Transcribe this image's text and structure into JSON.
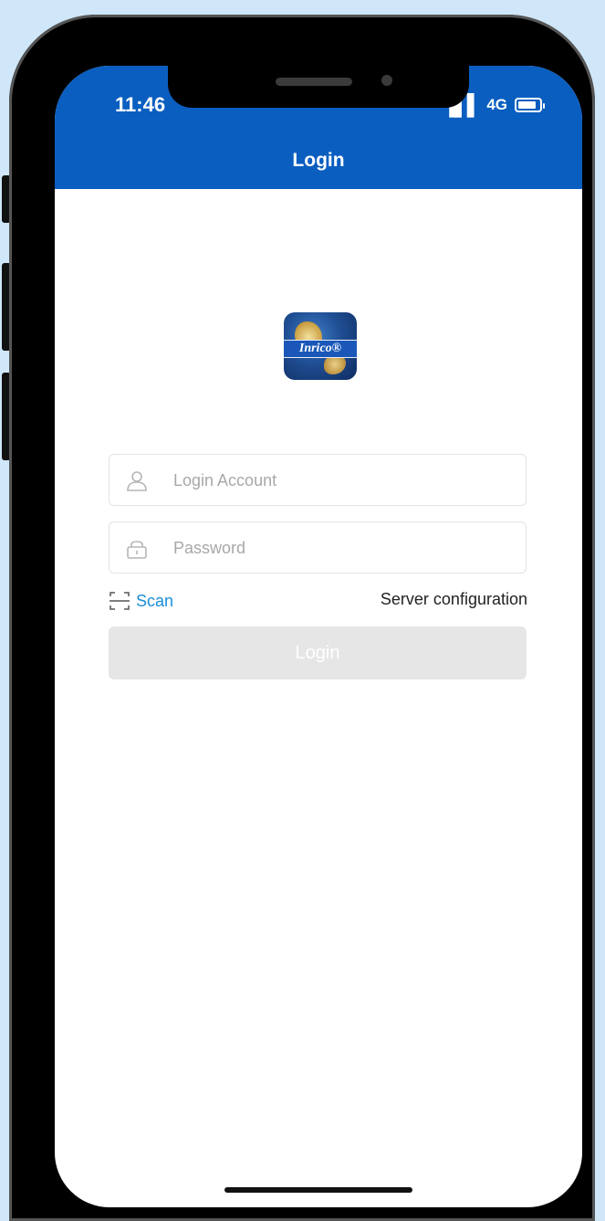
{
  "status_bar": {
    "time": "11:46",
    "signal_glyph": "▐▌▌",
    "network": "4G",
    "battery_icon": "battery-icon"
  },
  "header": {
    "title": "Login",
    "background": "#0a5ec0"
  },
  "logo": {
    "brand": "Inrico®"
  },
  "form": {
    "account_placeholder": "Login Account",
    "account_value": "",
    "password_placeholder": "Password",
    "password_value": "",
    "scan_label": "Scan",
    "server_config_label": "Server configuration",
    "login_button_label": "Login"
  },
  "colors": {
    "accent": "#1b8ed8",
    "disabled_button": "#e6e6e6",
    "background": "#cfe7f8"
  }
}
